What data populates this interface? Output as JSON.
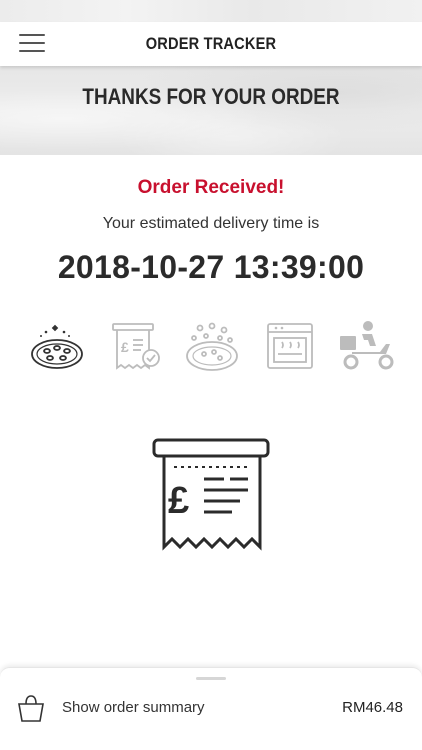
{
  "header": {
    "title": "ORDER TRACKER",
    "menu_icon": "hamburger-menu-icon"
  },
  "banner": {
    "title": "THANKS FOR YOUR ORDER"
  },
  "order": {
    "status": "Order Received!",
    "eta_label": "Your estimated delivery time is",
    "eta_time": "2018-10-27 13:39:00"
  },
  "steps": [
    {
      "icon": "pizza-icon",
      "state": "done"
    },
    {
      "icon": "receipt-check-icon",
      "state": "pending"
    },
    {
      "icon": "pizza-prep-icon",
      "state": "pending"
    },
    {
      "icon": "oven-icon",
      "state": "pending"
    },
    {
      "icon": "delivery-scooter-icon",
      "state": "pending"
    }
  ],
  "current_step_icon": "receipt-icon",
  "footer": {
    "summary_label": "Show order summary",
    "total": "RM46.48",
    "basket_icon": "basket-icon"
  },
  "colors": {
    "accent": "#c8102e",
    "text": "#222222",
    "inactive": "#bcbcbc"
  }
}
